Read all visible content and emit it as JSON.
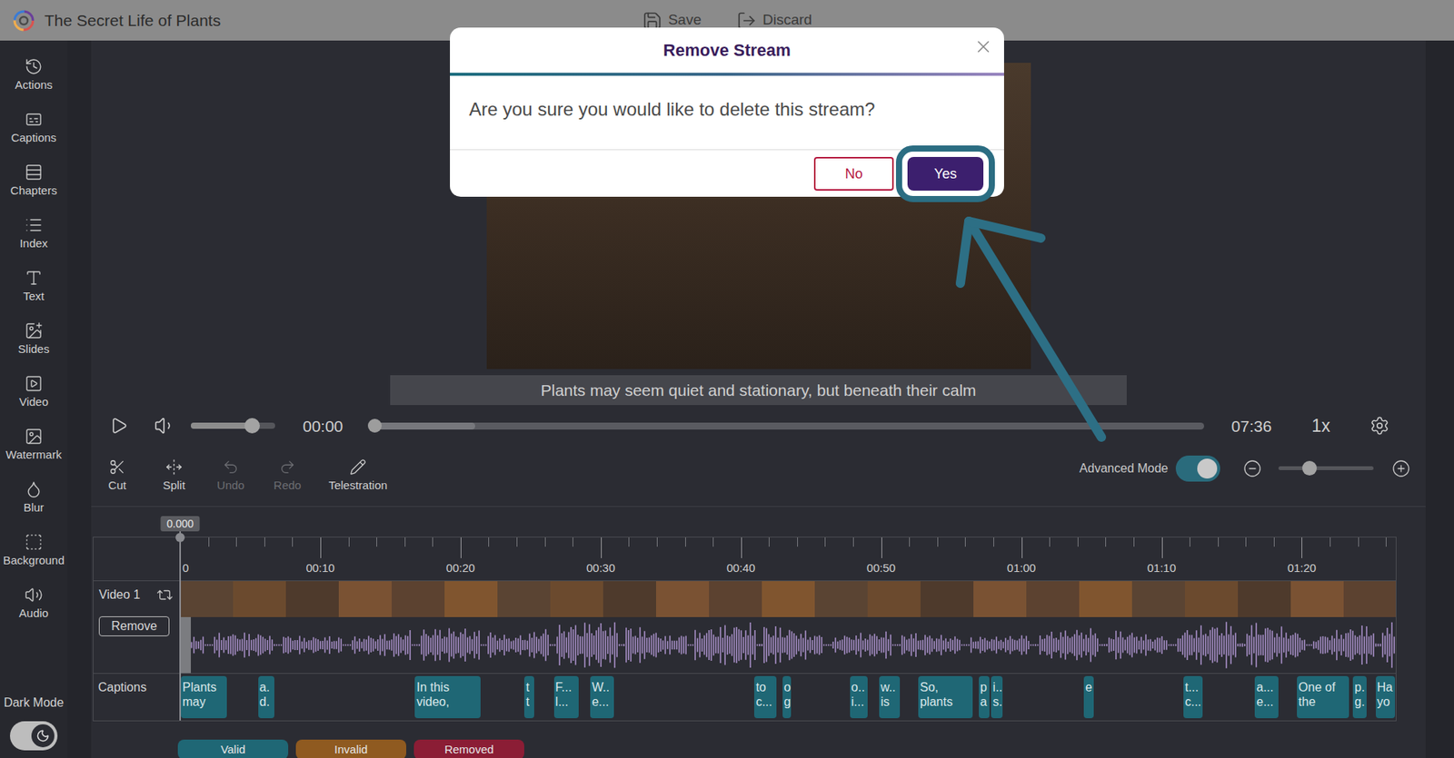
{
  "window": {
    "title": "The Secret Life of Plants"
  },
  "toolbar": [
    {
      "label": "Save"
    },
    {
      "label": "Discard"
    }
  ],
  "sidebar": {
    "items": [
      "Actions",
      "Captions",
      "Chapters",
      "Index",
      "Text",
      "Slides",
      "Video",
      "Watermark",
      "Blur",
      "Background",
      "Audio"
    ],
    "dark_mode": {
      "label": "Dark Mode",
      "on": true
    }
  },
  "player": {
    "caption": "Plants may seem quiet and stationary, but beneath their calm",
    "playing": false,
    "volume_level": 0.73,
    "time": "00:00",
    "progress_level": 0,
    "buffered_level": 0.127,
    "duration": "07:36",
    "speed": "1x"
  },
  "tools": [
    {
      "label": "Cut",
      "disabled": false
    },
    {
      "label": "Split",
      "disabled": false
    },
    {
      "label": "Undo",
      "disabled": true
    },
    {
      "label": "Redo",
      "disabled": true
    },
    {
      "label": "Telestration",
      "disabled": false
    }
  ],
  "advanced_mode": {
    "label": "Advanced Mode",
    "on": true
  },
  "zoom": {
    "level": 0.32
  },
  "timeline": {
    "playhead": "0.000",
    "ticks": [
      "0",
      "00:10",
      "00:20",
      "00:30",
      "00:40",
      "00:50",
      "01:00",
      "01:10",
      "01:20"
    ],
    "tracks": [
      {
        "kind": "video",
        "label": "Video 1",
        "button": "Remove"
      },
      {
        "kind": "captions",
        "label": "Captions"
      }
    ],
    "captions": [
      {
        "lines": [
          "Plants",
          "may"
        ],
        "start": 0,
        "end": 3.4
      },
      {
        "lines": [
          "a.",
          "d."
        ],
        "start": 5.5,
        "end": 6.8
      },
      {
        "lines": [
          "In this",
          "video,"
        ],
        "start": 16.7,
        "end": 21.5
      },
      {
        "lines": [
          "t",
          "t"
        ],
        "start": 24.5,
        "end": 25.3
      },
      {
        "lines": [
          "F...",
          "l..."
        ],
        "start": 26.6,
        "end": 28.5
      },
      {
        "lines": [
          "W..",
          "e..."
        ],
        "start": 29.2,
        "end": 31.0
      },
      {
        "lines": [
          "to",
          "c..."
        ],
        "start": 40.9,
        "end": 42.6
      },
      {
        "lines": [
          "o",
          "g"
        ],
        "start": 42.9,
        "end": 43.6
      },
      {
        "lines": [
          "o..",
          "i..."
        ],
        "start": 47.7,
        "end": 49.1
      },
      {
        "lines": [
          "w..",
          "is"
        ],
        "start": 49.8,
        "end": 51.4
      },
      {
        "lines": [
          "So,",
          "plants"
        ],
        "start": 52.6,
        "end": 56.6
      },
      {
        "lines": [
          "p",
          "a"
        ],
        "start": 56.9,
        "end": 57.8
      },
      {
        "lines": [
          "i..",
          "s."
        ],
        "start": 57.8,
        "end": 58.7
      },
      {
        "lines": [
          "e"
        ],
        "start": 64.4,
        "end": 65.2
      },
      {
        "lines": [
          "t...",
          "c..."
        ],
        "start": 71.5,
        "end": 73.0
      },
      {
        "lines": [
          "a...",
          "e..."
        ],
        "start": 76.6,
        "end": 78.4
      },
      {
        "lines": [
          "One of",
          "the"
        ],
        "start": 79.6,
        "end": 83.4
      },
      {
        "lines": [
          "p.",
          "g."
        ],
        "start": 83.6,
        "end": 84.7
      },
      {
        "lines": [
          "Ha",
          "yo"
        ],
        "start": 85.2,
        "end": 86.8
      }
    ]
  },
  "legend": [
    {
      "label": "Valid",
      "color": "#1f6775"
    },
    {
      "label": "Invalid",
      "color": "#8f5a20"
    },
    {
      "label": "Removed",
      "color": "#8b1d35"
    }
  ],
  "dialog": {
    "title": "Remove Stream",
    "message": "Are you sure you would like to delete this stream?",
    "buttons": [
      {
        "label": "No",
        "highlighted": false
      },
      {
        "label": "Yes",
        "highlighted": true
      }
    ]
  }
}
